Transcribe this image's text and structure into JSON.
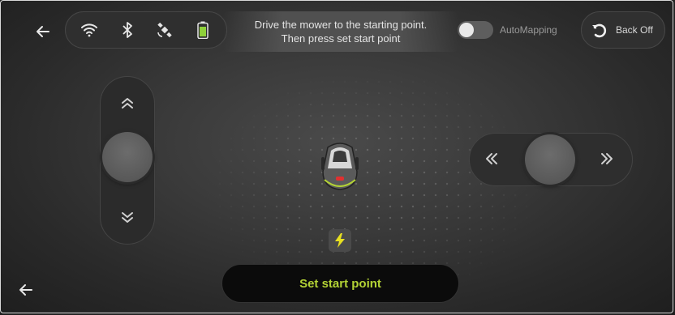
{
  "header": {
    "back_icon": "arrow-left-icon",
    "status_icons": [
      "wifi-icon",
      "bluetooth-icon",
      "satellite-icon",
      "battery-icon"
    ],
    "instruction_line1": "Drive the mower to the starting point.",
    "instruction_line2": "Then press set start point",
    "automapping_label": "AutoMapping",
    "automapping_on": false,
    "backoff_label": "Back Off"
  },
  "controls": {
    "vertical_joystick": {
      "up_icon": "double-chevron-up-icon",
      "down_icon": "double-chevron-down-icon"
    },
    "horizontal_joystick": {
      "left_icon": "double-chevron-left-icon",
      "right_icon": "double-chevron-right-icon"
    }
  },
  "map": {
    "mower_icon": "mower-icon",
    "charging_icon": "lightning-icon"
  },
  "footer": {
    "set_start_label": "Set start point",
    "back_icon": "arrow-left-icon"
  },
  "colors": {
    "accent": "#b3d235",
    "battery": "#8fd13a",
    "background": "#3a3a3a"
  }
}
